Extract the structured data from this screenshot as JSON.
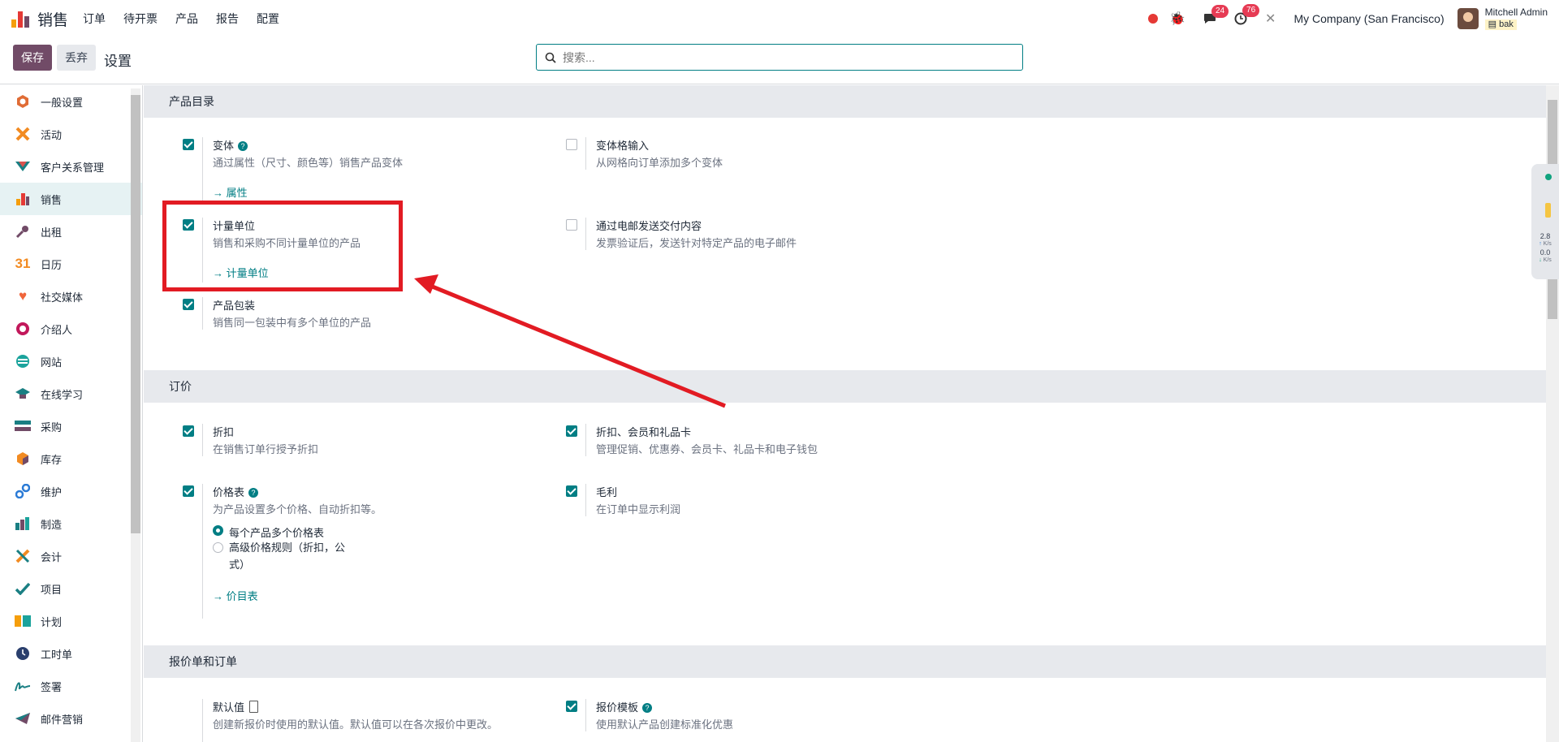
{
  "app": {
    "name": "销售",
    "colors": {
      "brand": "#714b67",
      "accent": "#017e84",
      "annotation": "#e21b23"
    }
  },
  "menu": [
    "订单",
    "待开票",
    "产品",
    "报告",
    "配置"
  ],
  "systray": {
    "messages_count": "24",
    "activities_count": "76",
    "company": "My Company (San Francisco)",
    "user_name": "Mitchell Admin",
    "db_name": "bak"
  },
  "control": {
    "save_label": "保存",
    "discard_label": "丢弃",
    "title": "设置",
    "search_placeholder": "搜索..."
  },
  "sidebar": {
    "items": [
      {
        "label": "一般设置",
        "icon": "settings-icon"
      },
      {
        "label": "活动",
        "icon": "discuss-icon"
      },
      {
        "label": "客户关系管理",
        "icon": "crm-icon"
      },
      {
        "label": "销售",
        "icon": "sales-icon"
      },
      {
        "label": "出租",
        "icon": "rental-icon"
      },
      {
        "label": "日历",
        "icon": "calendar-icon"
      },
      {
        "label": "社交媒体",
        "icon": "social-icon"
      },
      {
        "label": "介绍人",
        "icon": "referral-icon"
      },
      {
        "label": "网站",
        "icon": "website-icon"
      },
      {
        "label": "在线学习",
        "icon": "elearning-icon"
      },
      {
        "label": "采购",
        "icon": "purchase-icon"
      },
      {
        "label": "库存",
        "icon": "inventory-icon"
      },
      {
        "label": "维护",
        "icon": "maintenance-icon"
      },
      {
        "label": "制造",
        "icon": "manufacturing-icon"
      },
      {
        "label": "会计",
        "icon": "accounting-icon"
      },
      {
        "label": "项目",
        "icon": "project-icon"
      },
      {
        "label": "计划",
        "icon": "planning-icon"
      },
      {
        "label": "工时单",
        "icon": "timesheet-icon"
      },
      {
        "label": "签署",
        "icon": "sign-icon"
      },
      {
        "label": "邮件营销",
        "icon": "email-marketing-icon"
      }
    ]
  },
  "sections": {
    "catalog": {
      "title": "产品目录",
      "variants": {
        "title": "变体",
        "desc": "通过属性（尺寸、颜色等）销售产品变体",
        "link": "属性",
        "checked": true
      },
      "variant_grid": {
        "title": "变体格输入",
        "desc": "从网格向订单添加多个变体",
        "checked": false
      },
      "uom": {
        "title": "计量单位",
        "desc": "销售和采购不同计量单位的产品",
        "link": "计量单位",
        "checked": true
      },
      "email_delivery": {
        "title": "通过电邮发送交付内容",
        "desc": "发票验证后，发送针对特定产品的电子邮件",
        "checked": false
      },
      "packaging": {
        "title": "产品包装",
        "desc": "销售同一包装中有多个单位的产品",
        "checked": true
      }
    },
    "pricing": {
      "title": "订价",
      "discount": {
        "title": "折扣",
        "desc": "在销售订单行授予折扣",
        "checked": true
      },
      "loyalty": {
        "title": "折扣、会员和礼品卡",
        "desc": "管理促销、优惠券、会员卡、礼品卡和电子钱包",
        "checked": true
      },
      "pricelist": {
        "title": "价格表",
        "desc": "为产品设置多个价格、自动折扣等。",
        "checked": true,
        "option1": "每个产品多个价格表",
        "option2a": "高级价格规则（折扣，公",
        "option2b": "式）",
        "link": "价目表"
      },
      "margin": {
        "title": "毛利",
        "desc": "在订单中显示利润",
        "checked": true
      }
    },
    "quotations": {
      "title": "报价单和订单",
      "defaults": {
        "title": "默认值",
        "desc": "创建新报价时使用的默认值。默认值可以在各次报价中更改。"
      },
      "templates": {
        "title": "报价模板",
        "desc": "使用默认产品创建标准化优惠",
        "checked": true
      }
    }
  },
  "widget": {
    "up_value": "2.8",
    "up_unit": "K/s",
    "down_value": "0.0",
    "down_unit": "K/s"
  }
}
